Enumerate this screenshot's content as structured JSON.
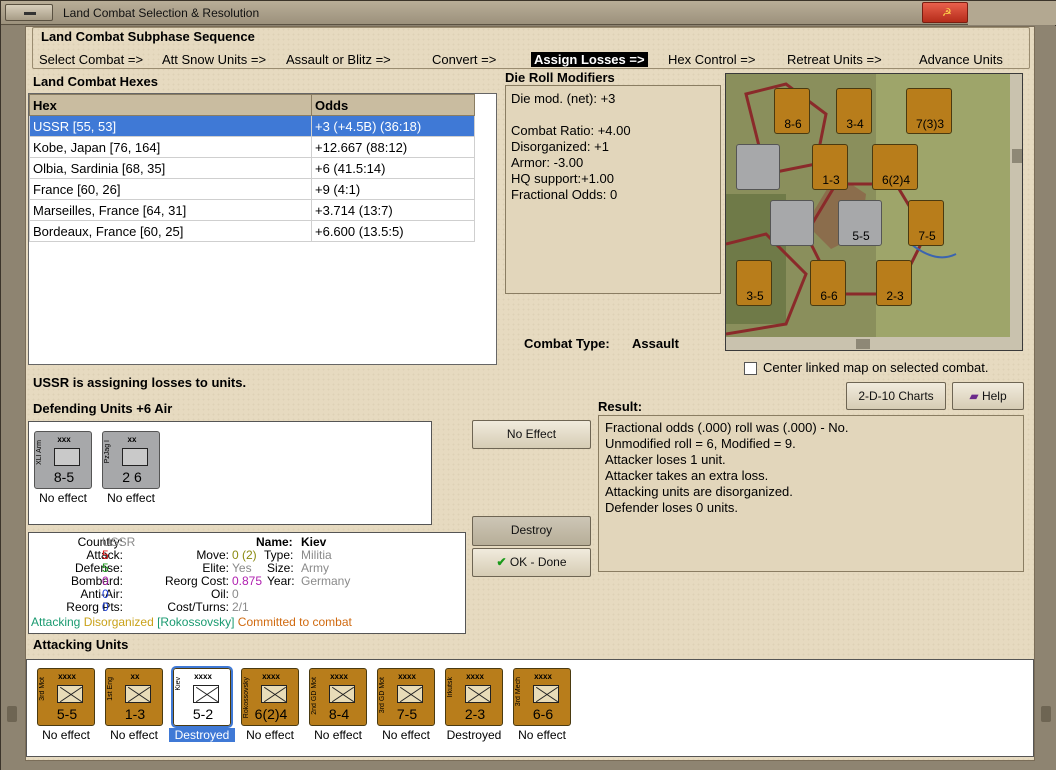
{
  "window": {
    "title": "Land Combat Selection & Resolution"
  },
  "subphase": {
    "heading": "Land Combat Subphase Sequence",
    "steps": [
      "Select Combat =>",
      "Att Snow Units =>",
      "Assault or Blitz =>",
      "Convert =>",
      "Assign Losses =>",
      "Hex Control =>",
      "Retreat Units =>",
      "Advance Units"
    ],
    "active_index": 4
  },
  "hexes": {
    "heading": "Land Combat Hexes",
    "columns": [
      "Hex",
      "Odds"
    ],
    "rows": [
      [
        "USSR [55, 53]",
        "+3 (+4.5B) (36:18)"
      ],
      [
        "Kobe, Japan [76, 164]",
        "+12.667 (88:12)"
      ],
      [
        "Olbia, Sardinia [68, 35]",
        "+6 (41.5:14)"
      ],
      [
        "France [60, 26]",
        "+9 (4:1)"
      ],
      [
        "Marseilles, France [64, 31]",
        "+3.714 (13:7)"
      ],
      [
        "Bordeaux, France [60, 25]",
        "+6.600 (13.5:5)"
      ]
    ],
    "selected_index": 0
  },
  "modifiers": {
    "heading": "Die Roll Modifiers",
    "lines": [
      "Die mod. (net): +3",
      "",
      "Combat Ratio: +4.00",
      "Disorganized: +1",
      "Armor: -3.00",
      "HQ support:+1.00",
      "Fractional Odds: 0"
    ]
  },
  "combat_type": {
    "label": "Combat Type:",
    "value": "Assault"
  },
  "center_map": {
    "label": "Center linked map on selected combat.",
    "checked": false
  },
  "status_line": "USSR is assigning losses to units.",
  "buttons": {
    "charts": "2-D-10 Charts",
    "help": "Help",
    "no_effect": "No Effect",
    "destroy": "Destroy",
    "ok": "OK - Done"
  },
  "result": {
    "heading": "Result:",
    "lines": [
      "Fractional odds (.000) roll was (.000)  - No.",
      "Unmodified roll = 6, Modified = 9.",
      "Attacker loses 1 unit.",
      "Attacker takes an extra loss.",
      "Attacking units are disorganized.",
      "Defender loses 0 units."
    ]
  },
  "defending": {
    "heading": "Defending Units +6 Air",
    "units": [
      {
        "size": "xxx",
        "name": "XLI Arm",
        "values": "8-5",
        "status": "No effect",
        "color": "#a7a8aa"
      },
      {
        "size": "xx",
        "name": "PzJag I",
        "values": "2  6",
        "status": "No effect",
        "color": "#a7a8aa"
      }
    ]
  },
  "unit_info": {
    "country_label": "Country:",
    "country": "USSR",
    "attack_label": "Attack:",
    "attack": "5",
    "defense_label": "Defense:",
    "defense": "5",
    "bombard_label": "Bombard:",
    "bombard": "0",
    "antiair_label": "Anti-Air:",
    "antiair": "0",
    "reorg_pts_label": "Reorg Pts:",
    "reorg_pts": "0",
    "name_label": "Name:",
    "name": "Kiev",
    "move_label": "Move:",
    "move": "0 (2)",
    "elite_label": "Elite:",
    "elite": "Yes",
    "reorg_cost_label": "Reorg Cost:",
    "reorg_cost": "0.875",
    "oil_label": "Oil:",
    "oil": "0",
    "cost_turns_label": "Cost/Turns:",
    "cost_turns": "2/1",
    "type_label": "Type:",
    "type": "Militia",
    "size_label": "Size:",
    "size": "Army",
    "year_label": "Year:",
    "year": "Germany",
    "flags": [
      "Attacking",
      "Disorganized",
      "[Rokossovsky]",
      "Committed to combat"
    ]
  },
  "attacking": {
    "heading": "Attacking Units",
    "units": [
      {
        "size": "xxxx",
        "name": "3rd Mot",
        "values": "5-5",
        "status": "No effect"
      },
      {
        "size": "xx",
        "name": "1st Eng",
        "values": "1-3",
        "status": "No effect"
      },
      {
        "size": "xxxx",
        "name": "Kiev",
        "values": "5-2",
        "status": "Destroyed"
      },
      {
        "size": "xxxx",
        "name": "Rokossovsky",
        "values": "6(2)4",
        "status": "No effect"
      },
      {
        "size": "xxxx",
        "name": "2nd GD Mot",
        "values": "8-4",
        "status": "No effect"
      },
      {
        "size": "xxxx",
        "name": "3rd GD Mot",
        "values": "7-5",
        "status": "No effect"
      },
      {
        "size": "xxxx",
        "name": "Irkutsk",
        "values": "2-3",
        "status": "Destroyed"
      },
      {
        "size": "xxxx",
        "name": "3rd Mech",
        "values": "6-6",
        "status": "No effect"
      }
    ],
    "selected_index": 2
  },
  "map_counters": [
    {
      "values": "8-6"
    },
    {
      "values": "3-4"
    },
    {
      "values": "7(3)3"
    },
    {
      "values": "1-3"
    },
    {
      "values": "6(2)4"
    },
    {
      "values": "5-5"
    },
    {
      "values": "7-5"
    },
    {
      "values": "3-5"
    },
    {
      "values": "6-6"
    },
    {
      "values": "2-3"
    }
  ],
  "colors": {
    "parchment": "#e6dac0",
    "counter_soviet": "#b87d1b",
    "counter_german": "#a7a8aa",
    "selection": "#3f79d6"
  }
}
